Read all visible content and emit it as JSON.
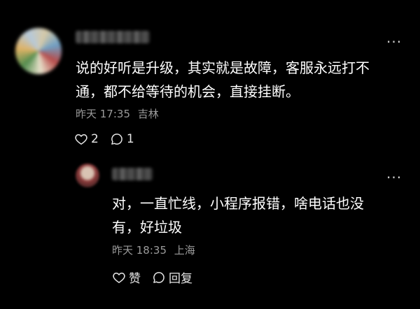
{
  "comments": [
    {
      "text_line1": "说的好听是升级，其实就是故障，客服永远打不",
      "text_line2": "通，都不给等待的机会，直接挂断。",
      "date": "昨天 17:35",
      "location": "吉林",
      "like_count": "2",
      "reply_count": "1",
      "more_label": "···"
    },
    {
      "text_line1": "对，一直忙线，小程序报错，啥电话也没",
      "text_line2": "有，好垃圾",
      "date": "昨天 18:35",
      "location": "上海",
      "like_label": "赞",
      "reply_label": "回复",
      "more_label": "···"
    }
  ],
  "colors": {
    "background": "#000000",
    "text": "#ffffff",
    "meta": "#9b9b9b"
  },
  "icons": [
    "heart-icon",
    "comment-bubble-icon",
    "more-dots-icon"
  ]
}
